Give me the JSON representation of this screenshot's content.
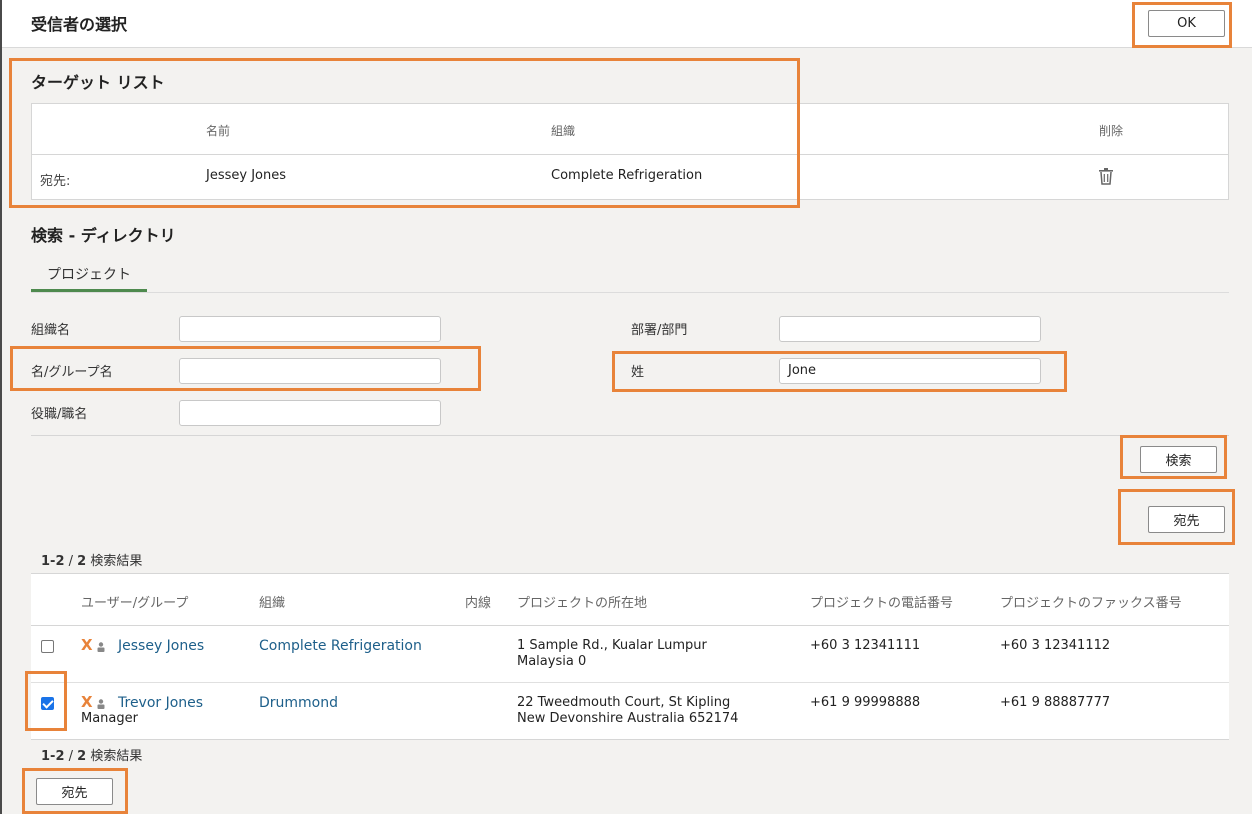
{
  "header": {
    "title": "受信者の選択",
    "ok_label": "OK"
  },
  "target_list": {
    "title": "ターゲット リスト",
    "columns": {
      "name": "名前",
      "org": "組織",
      "delete": "削除"
    },
    "row": {
      "type": "宛先:",
      "name": "Jessey Jones",
      "org": "Complete Refrigeration",
      "delete_icon": "trash-icon"
    }
  },
  "search": {
    "title": "検索 - ディレクトリ",
    "tab": "プロジェクト",
    "fields": {
      "org_name": {
        "label": "組織名",
        "value": ""
      },
      "first_name": {
        "label": "名/グループ名",
        "value": ""
      },
      "job_title": {
        "label": "役職/職名",
        "value": ""
      },
      "department": {
        "label": "部署/部門",
        "value": ""
      },
      "last_name": {
        "label": "姓",
        "value": "Jone"
      }
    },
    "search_button": "検索",
    "to_button": "宛先"
  },
  "results": {
    "count_prefix": "1-2",
    "count_sep": " / ",
    "count_total": "2",
    "count_suffix": " 検索結果",
    "columns": {
      "user": "ユーザー/グループ",
      "org": "組織",
      "ext": "内線",
      "location": "プロジェクトの所在地",
      "phone": "プロジェクトの電話番号",
      "fax": "プロジェクトのファックス番号"
    },
    "rows": [
      {
        "checked": false,
        "name": "Jessey Jones",
        "role": "",
        "org": "Complete Refrigeration",
        "location_line1": "1 Sample Rd., Kualar Lumpur",
        "location_line2": "Malaysia 0",
        "phone": "+60 3 12341111",
        "fax": "+60 3 12341112"
      },
      {
        "checked": true,
        "name": "Trevor Jones",
        "role": "Manager",
        "org": "Drummond",
        "location_line1": "22 Tweedmouth Court, St Kipling",
        "location_line2": "New Devonshire Australia 652174",
        "phone": "+61 9 99998888",
        "fax": "+61 9 88887777"
      }
    ],
    "bottom_to_button": "宛先"
  },
  "colors": {
    "accent_highlight": "#e8833a",
    "link": "#1d5f8a",
    "tab_underline": "#4e8a4e",
    "checkbox": "#1a73e8"
  }
}
